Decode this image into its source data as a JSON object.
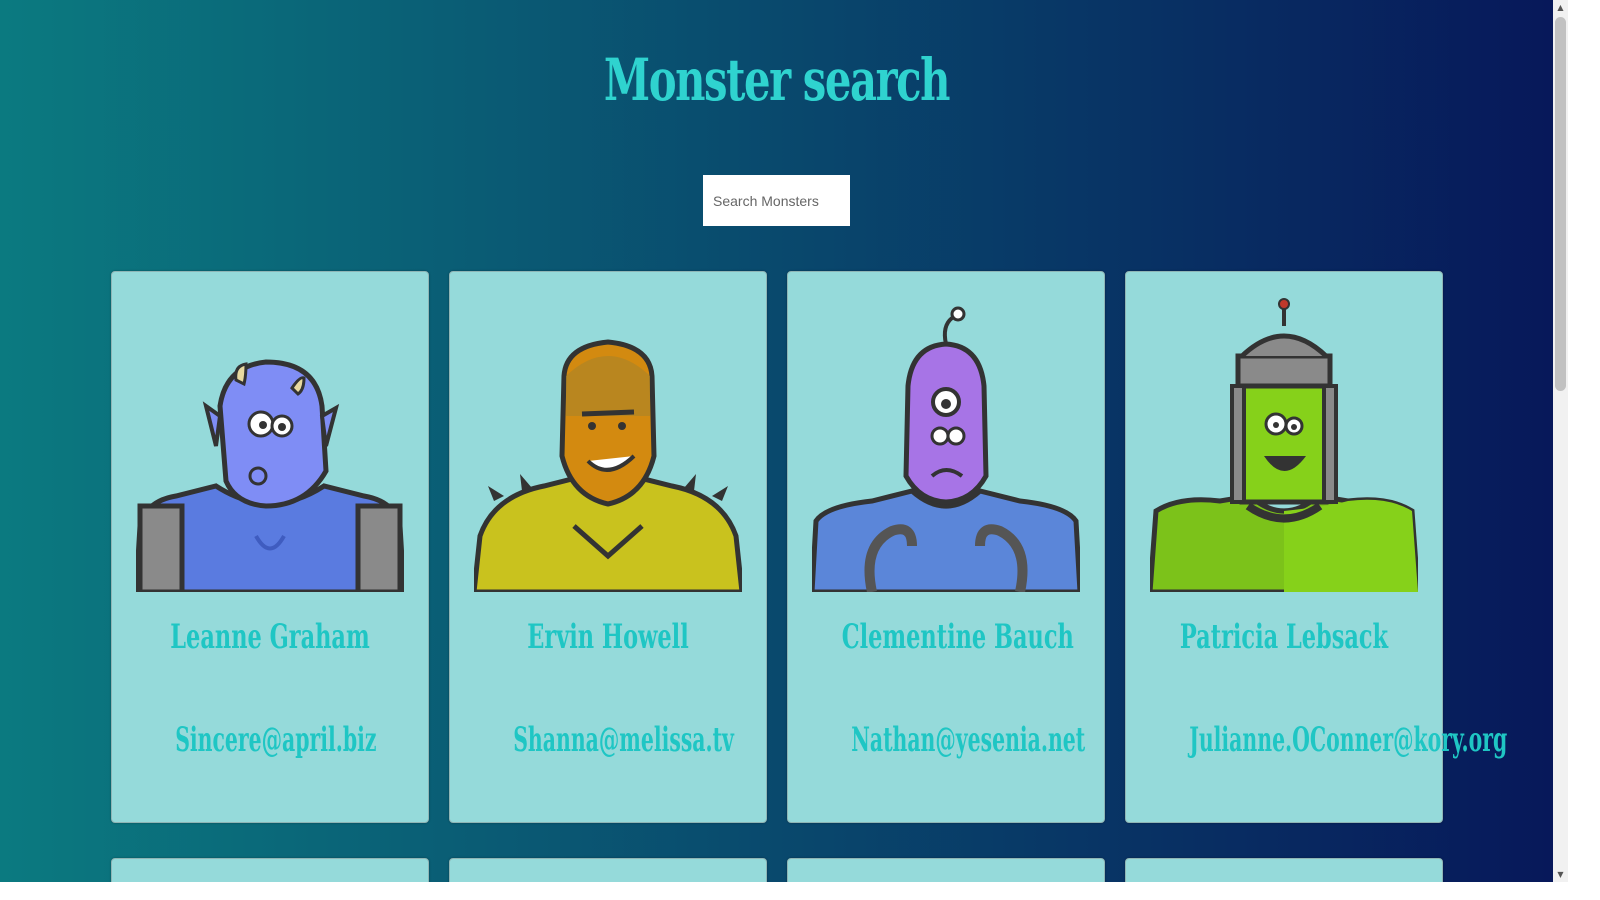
{
  "header": {
    "title": "Monster search"
  },
  "search": {
    "placeholder": "Search Monsters",
    "value": ""
  },
  "monsters": [
    {
      "name": "Leanne Graham",
      "email": "Sincere@april.biz",
      "skin": "#7f8df5",
      "body": "#5a7be0"
    },
    {
      "name": "Ervin Howell",
      "email": "Shanna@melissa.tv",
      "skin": "#d38a10",
      "body": "#c9c21e"
    },
    {
      "name": "Clementine Bauch",
      "email": "Nathan@yesenia.net",
      "skin": "#a774e6",
      "body": "#5b86d9"
    },
    {
      "name": "Patricia Lebsack",
      "email": "Julianne.OConner@kory.org",
      "skin": "#86d11a",
      "body": "#7cc21a"
    },
    {
      "name": "",
      "email": ""
    },
    {
      "name": "",
      "email": ""
    },
    {
      "name": "",
      "email": ""
    },
    {
      "name": "",
      "email": ""
    }
  ],
  "scrollbar": {
    "up_icon": "triangle-up",
    "down_icon": "triangle-down"
  }
}
